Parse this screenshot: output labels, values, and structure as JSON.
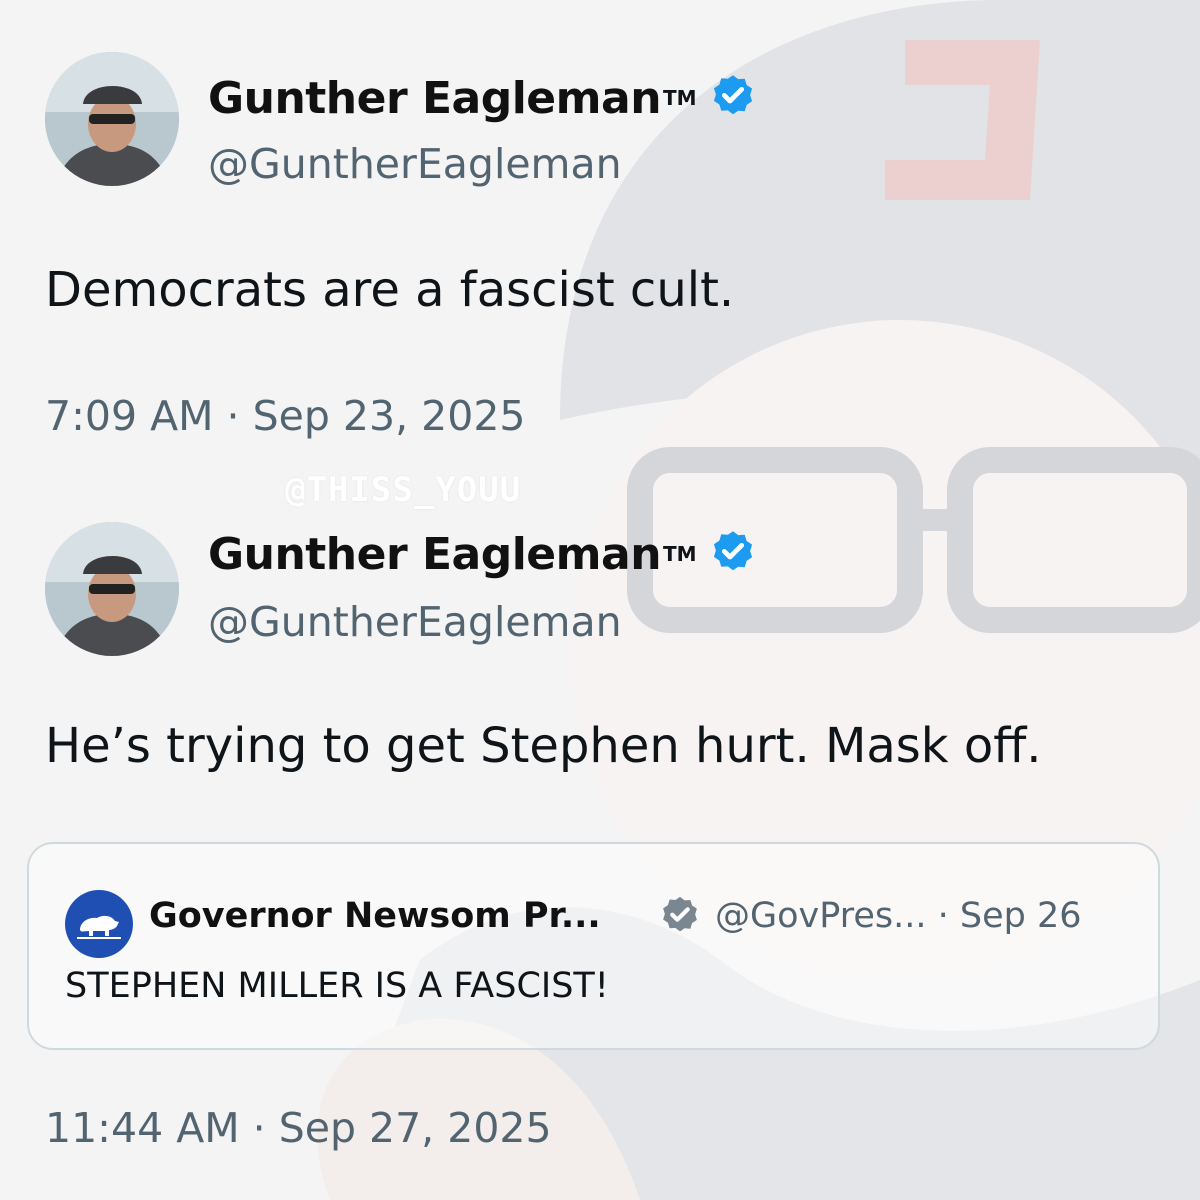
{
  "tweets": [
    {
      "name": "Gunther Eagleman",
      "trademark": "TM",
      "handle": "@GuntherEagleman",
      "text": "Democrats are a fascist cult.",
      "time": "7:09 AM · Sep 23, 2025"
    },
    {
      "name": "Gunther Eagleman",
      "trademark": "TM",
      "handle": "@GuntherEagleman",
      "text": "He’s trying to get Stephen hurt. Mask off.",
      "time": "11:44 AM · Sep 27, 2025",
      "quote": {
        "name": "Governor Newsom Pr...",
        "handle_date": "@GovPres... · Sep 26",
        "text": "STEPHEN MILLER IS A FASCIST!"
      }
    }
  ],
  "watermark": "@THISS_YOUU",
  "colors": {
    "verified_blue": "#1d9bf0",
    "gray_verified": "#7a8791",
    "secondary_text": "#536471",
    "quote_avatar_bg": "#1f4fb3"
  },
  "icons": {
    "verified": "verified-badge-icon",
    "quote_verified": "gray-verified-badge-icon",
    "quote_avatar": "california-bear-icon"
  }
}
